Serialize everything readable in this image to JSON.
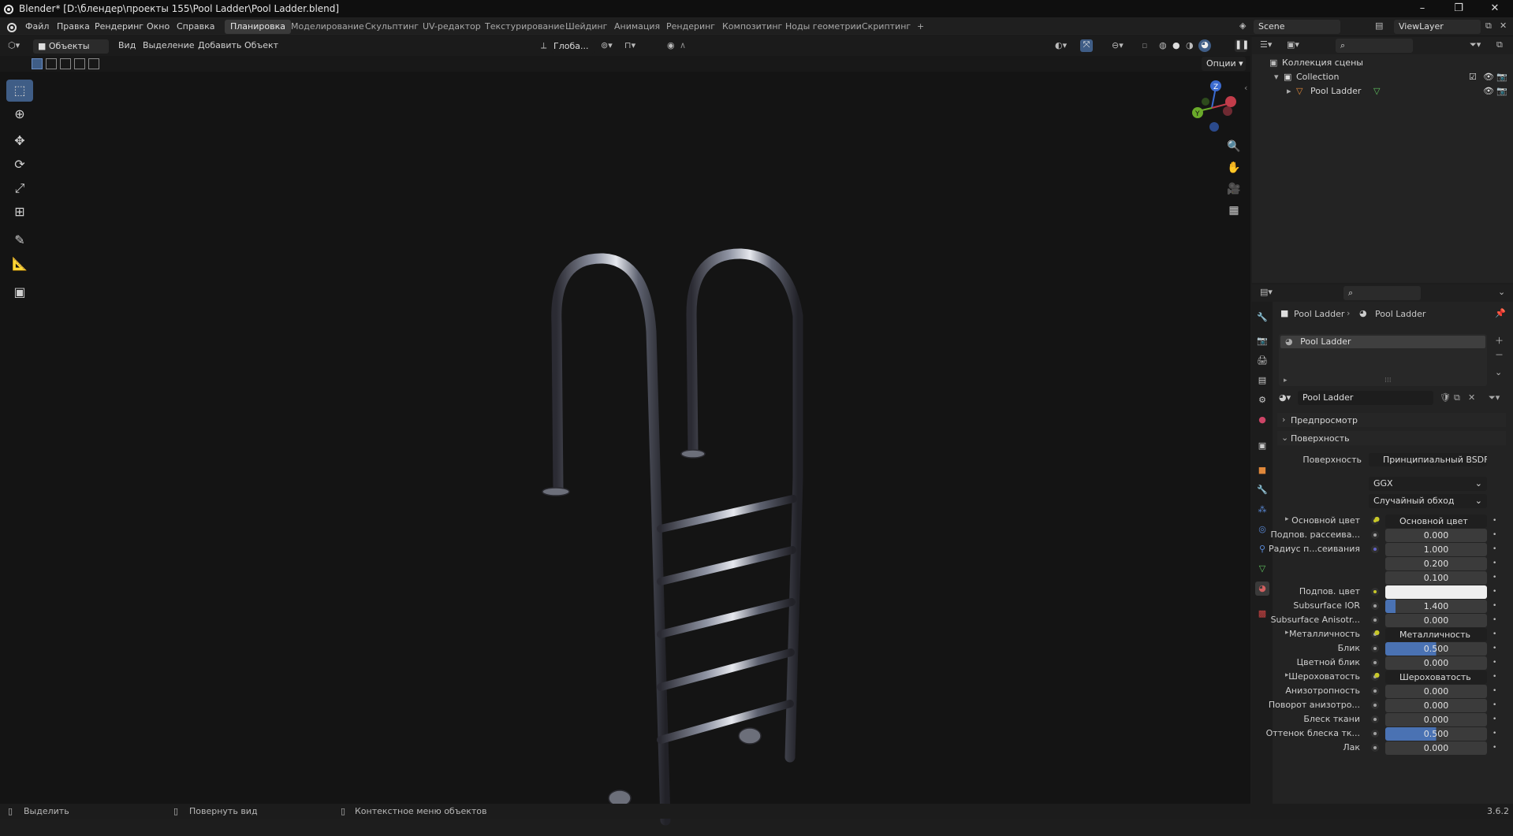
{
  "window": {
    "title": "Blender* [D:\\блендер\\проекты 155\\Pool Ladder\\Pool Ladder.blend]",
    "minimize": "–",
    "maximize": "❐",
    "close": "✕"
  },
  "menu": [
    "Файл",
    "Правка",
    "Рендеринг",
    "Окно",
    "Справка"
  ],
  "workspaces": {
    "active": "Планировка",
    "tabs": [
      "Планировка",
      "Моделирование",
      "Скульптинг",
      "UV-редактор",
      "Текстурирование",
      "Шейдинг",
      "Анимация",
      "Рендеринг",
      "Композитинг",
      "Ноды геометрии",
      "Скриптинг"
    ],
    "add": "+"
  },
  "scene": {
    "name": "Scene",
    "view_layer": "ViewLayer"
  },
  "viewport_header": {
    "mode": "Объекты",
    "menus": [
      "Вид",
      "Выделение",
      "Добавить",
      "Объект"
    ],
    "orientation": "Глоба...",
    "options": "Опции"
  },
  "outliner": {
    "root": "Коллекция сцены",
    "collection": "Collection",
    "object": "Pool Ladder"
  },
  "properties": {
    "breadcrumb_object": "Pool Ladder",
    "breadcrumb_material": "Pool Ladder",
    "slot": "Pool Ladder",
    "material_name": "Pool Ladder",
    "preview_label": "Предпросмотр",
    "surface_section": "Поверхность",
    "surface_label": "Поверхность",
    "surface_value": "Принципиальный BSDF",
    "distribution": "GGX",
    "subsurface_method": "Случайный обход",
    "rows": [
      {
        "label": "Основной цвет",
        "value": "Основной цвет",
        "kind": "link",
        "expand": true,
        "socket": "#c7c729"
      },
      {
        "label": "Подпов. рассеива...",
        "value": "0.000",
        "kind": "num",
        "socket": "#a1a1a1"
      },
      {
        "label": "Радиус п...сеивания",
        "value": "1.000",
        "kind": "num",
        "socket": "#6363c7"
      },
      {
        "label": "",
        "value": "0.200",
        "kind": "num"
      },
      {
        "label": "",
        "value": "0.100",
        "kind": "num"
      },
      {
        "label": "Подпов. цвет",
        "value": "",
        "kind": "color",
        "socket": "#c7c729"
      },
      {
        "label": "Subsurface IOR",
        "value": "1.400",
        "kind": "num",
        "fill": 0.1,
        "socket": "#a1a1a1"
      },
      {
        "label": "Subsurface Anisotr...",
        "value": "0.000",
        "kind": "num",
        "socket": "#a1a1a1"
      },
      {
        "label": "Металличность",
        "value": "Металличность",
        "kind": "link",
        "expand": true,
        "socket": "#a1a1a1"
      },
      {
        "label": "Блик",
        "value": "0.500",
        "kind": "num",
        "fill": 0.5,
        "socket": "#a1a1a1"
      },
      {
        "label": "Цветной блик",
        "value": "0.000",
        "kind": "num",
        "socket": "#a1a1a1"
      },
      {
        "label": "Шероховатость",
        "value": "Шероховатость",
        "kind": "link",
        "expand": true,
        "socket": "#a1a1a1"
      },
      {
        "label": "Анизотропность",
        "value": "0.000",
        "kind": "num",
        "socket": "#a1a1a1"
      },
      {
        "label": "Поворот анизотро...",
        "value": "0.000",
        "kind": "num",
        "socket": "#a1a1a1"
      },
      {
        "label": "Блеск ткани",
        "value": "0.000",
        "kind": "num",
        "socket": "#a1a1a1"
      },
      {
        "label": "Оттенок блеска тк...",
        "value": "0.500",
        "kind": "num",
        "fill": 0.5,
        "socket": "#a1a1a1"
      },
      {
        "label": "Лак",
        "value": "0.000",
        "kind": "num",
        "socket": "#a1a1a1"
      }
    ]
  },
  "statusbar": {
    "select": "Выделить",
    "rotate": "Повернуть вид",
    "context": "Контекстное меню объектов",
    "version": "3.6.2"
  },
  "colors": {
    "accent": "#4a72b3",
    "active_tool": "#3f5d86"
  }
}
